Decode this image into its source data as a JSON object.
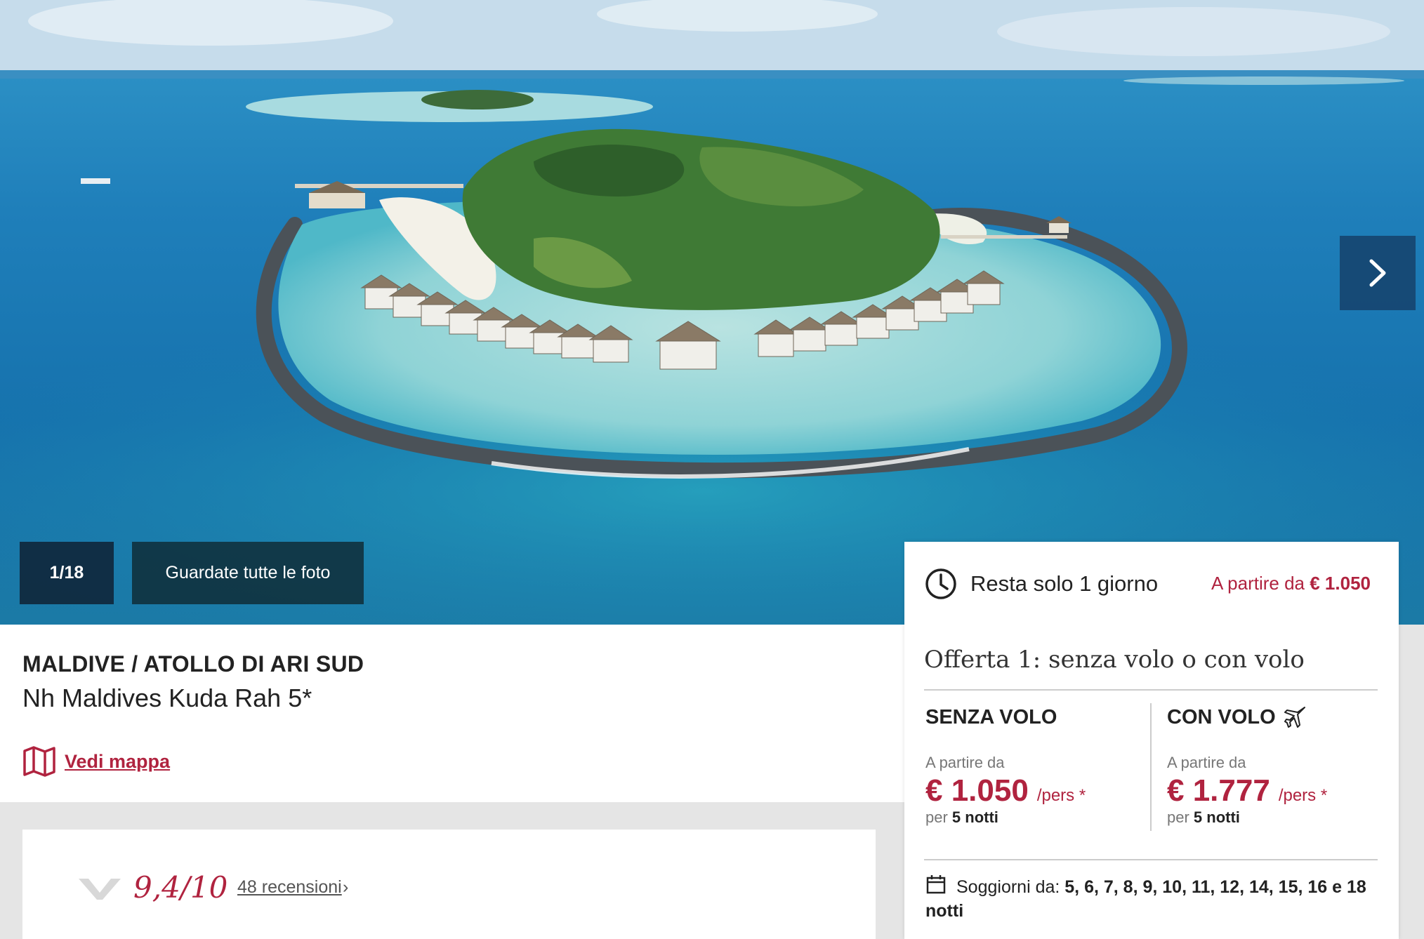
{
  "gallery": {
    "counter": "1/18",
    "all_photos_label": "Guardate tutte le foto"
  },
  "hotel": {
    "location": "MALDIVE / ATOLLO DI ARI SUD",
    "name": "Nh Maldives Kuda Rah 5*",
    "map_label": "Vedi mappa"
  },
  "reviews": {
    "score": "9,4/10",
    "count_label": "48 recensioni"
  },
  "offer": {
    "time_left": "Resta solo 1 giorno",
    "from_prefix": "A partire da",
    "from_price": "€ 1.050",
    "title": "Offerta 1: senza volo o con volo",
    "options": [
      {
        "label": "SENZA VOLO",
        "from": "A partire da",
        "price": "€ 1.050",
        "per": "/pers *",
        "nights_prefix": "per",
        "nights": "5 notti"
      },
      {
        "label": "CON VOLO",
        "from": "A partire da",
        "price": "€ 1.777",
        "per": "/pers *",
        "nights_prefix": "per",
        "nights": "5 notti"
      }
    ],
    "stays_label": "Soggiorni da:",
    "stays_values": "5, 6, 7, 8, 9, 10, 11, 12, 14, 15, 16 e 18 notti"
  },
  "colors": {
    "accent": "#b0233f",
    "text": "#222222"
  },
  "icons": [
    "chevron-right-icon",
    "map-icon",
    "clock-icon",
    "plane-icon",
    "calendar-icon",
    "reviews-logo-icon"
  ]
}
